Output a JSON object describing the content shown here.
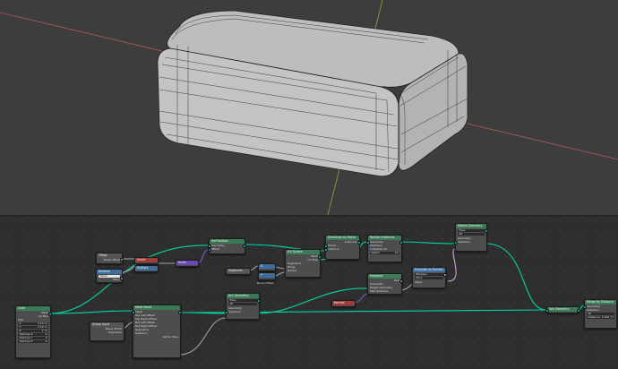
{
  "colors": {
    "geometry_socket": "#00d6a3",
    "float_socket": "#a1a1a1",
    "vector_socket": "#6363c7",
    "header_geometry": "#3b7a57",
    "header_input": "#a33a3a",
    "header_vector": "#3d6e9c",
    "header_utility": "#6a4ab0",
    "viewport_bg": "#3d3d3d",
    "editor_bg": "#2e2e2e"
  },
  "nodes": {
    "cube": {
      "title": "Cube",
      "out_mesh": "Mesh",
      "out_uv": "UV Map",
      "size_label": "Size",
      "x_label": "X",
      "x_value": "2.15 m",
      "y_label": "Y",
      "y_value": "1.34 m",
      "z_label": "Z",
      "z_value": "1 m",
      "vx_label": "Vertices X",
      "vx_value": "2",
      "vy_label": "Vertices Y",
      "vy_value": "2",
      "vz_label": "Vertices Z",
      "vz_value": "2"
    },
    "offset_input": {
      "title": "Offset",
      "field": "Bevel Offset"
    },
    "relative": {
      "title": "Relative",
      "field": "Value",
      "row": "Value"
    },
    "invert": {
      "title": "Invert"
    },
    "multiply": {
      "title": "Multiply"
    },
    "scale": {
      "title": "Scale"
    },
    "set_position": {
      "title": "Set Position",
      "geometry": "Geometry",
      "offset": "Offset"
    },
    "group_input_bottom": {
      "title": "Group Input",
      "field1": "Bevel Offset",
      "field2": "Segments"
    },
    "mesh_bevel": {
      "title": "Mesh Bevel",
      "rows": [
        "Mesh",
        "Top Left Offset",
        "Top Right Offset",
        "Bot Left Offset",
        "Bot Right Offset",
        "Segments"
      ],
      "sel": "Selection",
      "out": "Vertex Face"
    },
    "segments_input": {
      "title": "Segments"
    },
    "x_node": {
      "label": "X"
    },
    "y_node": {
      "label": "Y"
    },
    "bevel_offset_label": "Bevel Offset",
    "uv_sphere": {
      "title": "UV Sphere",
      "out_mesh": "Mesh",
      "out_uv": "UV Map",
      "rows": [
        "Segments",
        "Rings",
        "Radius"
      ]
    },
    "distribute_points": {
      "title": "Distribute on Points",
      "out": "Instances",
      "rows": [
        "Points",
        "Instance"
      ]
    },
    "realize_instances": {
      "title": "Realize Instances",
      "rows": [
        "Geometry",
        "Selection"
      ],
      "realize_all": "Realize All",
      "depth_label": "Depth",
      "depth_value": "10"
    },
    "delete_geometry": {
      "title": "Delete Geometry",
      "field1": "Face",
      "field2": "All",
      "rows": [
        "Geometry",
        "Selection"
      ]
    },
    "separate": {
      "title": "Separate",
      "rows": [
        "Geometry",
        "Target Geometry",
        "Max Distance"
      ],
      "out": "Dist"
    },
    "normal": {
      "title": "Normal"
    },
    "evaluate_domain": {
      "title": "Evaluate on Domain",
      "field1": "Boolean",
      "field2": "Face",
      "row": "Value"
    },
    "join_geometry_mid": {
      "title": "Join Geometry",
      "field1": "Face",
      "field2": "All",
      "rows": [
        "Geometry",
        "Selection"
      ]
    },
    "join_geometry": {
      "title": "Join Geometry"
    },
    "merge_by_distance": {
      "title": "Merge by Distance",
      "rows": [
        "Geometry",
        "Selection"
      ],
      "mode": "All",
      "dist_label": "Distance",
      "dist_value": "0.001 m"
    }
  }
}
